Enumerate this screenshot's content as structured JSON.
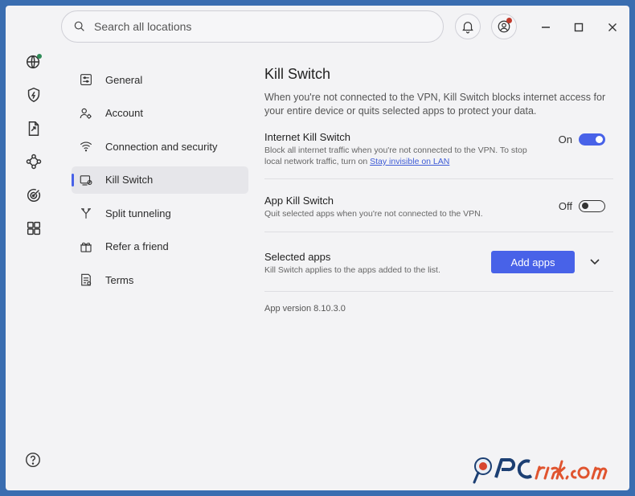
{
  "search": {
    "placeholder": "Search all locations"
  },
  "nav": {
    "items": [
      {
        "label": "General",
        "icon": "sliders-icon"
      },
      {
        "label": "Account",
        "icon": "user-gear-icon"
      },
      {
        "label": "Connection and security",
        "icon": "wifi-icon"
      },
      {
        "label": "Kill Switch",
        "icon": "kill-switch-icon",
        "active": true
      },
      {
        "label": "Split tunneling",
        "icon": "split-icon"
      },
      {
        "label": "Refer a friend",
        "icon": "gift-icon"
      },
      {
        "label": "Terms",
        "icon": "document-icon"
      }
    ]
  },
  "content": {
    "title": "Kill Switch",
    "description": "When you're not connected to the VPN, Kill Switch blocks internet access for your entire device or quits selected apps to protect your data.",
    "internet_kill_switch": {
      "title": "Internet Kill Switch",
      "sub": "Block all internet traffic when you're not connected to the VPN. To stop local network traffic, turn on",
      "link": "Stay invisible on LAN",
      "state": "On"
    },
    "app_kill_switch": {
      "title": "App Kill Switch",
      "sub": "Quit selected apps when you're not connected to the VPN.",
      "state": "Off"
    },
    "selected_apps": {
      "title": "Selected apps",
      "sub": "Kill Switch applies to the apps added to the list.",
      "button": "Add apps"
    },
    "version": "App version 8.10.3.0"
  },
  "colors": {
    "accent": "#4862e8",
    "notification_dot": "#c0392b",
    "status_dot": "#2e8b57"
  }
}
